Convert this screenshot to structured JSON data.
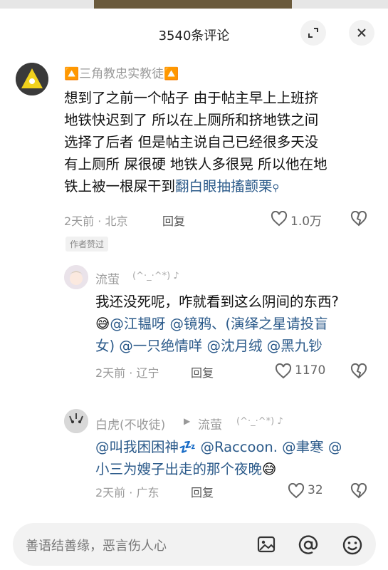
{
  "header": {
    "title": "3540条评论"
  },
  "comments": [
    {
      "username": "🔼三角教忠实教徒🔼",
      "lines": [
        "想到了之前一个帖子 由于帖主早上上班挤",
        "地铁快迟到了 所以在上厕所和挤地铁之间",
        "选择了后者 但是帖主说自己已经很多天没",
        "有上厕所 屎很硬 地铁人多很晃 所以他在地"
      ],
      "last_line_text": "铁上被一根屎干到",
      "last_line_link": "翻白眼抽搐颤栗",
      "time_location": "2天前 · 北京",
      "reply_label": "回复",
      "likes": "1.0万",
      "tag": "作者赞过"
    },
    {
      "username": "流萤",
      "kaomoji": "(^·_·^*) ♪",
      "text": "我还没死呢，咋就看到这么阴间的东西?",
      "emoji": "😅",
      "mentions_line1": "@江韫呀 @镜鸦、(演绎之星请投盲",
      "mentions_line2": "女) @一只绝情咩 @沈月绒 @黑九钞",
      "time_location": "2天前 · 辽宁",
      "reply_label": "回复",
      "likes": "1170"
    },
    {
      "username": "白虎(不收徒)",
      "reply_to": "流萤",
      "kaomoji": "(^·_·^*) ♪",
      "line1_mention": "@叫我困困神",
      "line1_emoji": "💤",
      "line1_rest": " @Raccoon. @聿寒 @",
      "line2_mention": "小三为嫂子出走的那个夜晚",
      "line2_emoji": "😅",
      "time_location": "2天前 · 广东",
      "reply_label": "回复",
      "likes": "32"
    }
  ],
  "input": {
    "placeholder": "善语结善缘，恶言伤人心"
  },
  "icons": [
    "expand-icon",
    "close-icon",
    "heart-icon",
    "dislike-icon",
    "image-icon",
    "at-icon",
    "emoji-icon",
    "search-icon"
  ]
}
